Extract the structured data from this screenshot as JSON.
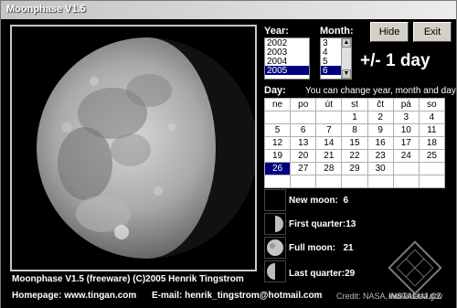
{
  "window": {
    "title": "Moonphase V1.5"
  },
  "year": {
    "label": "Year:",
    "options": [
      "2002",
      "2003",
      "2004",
      "2005"
    ],
    "selected": "2005"
  },
  "month": {
    "label": "Month:",
    "options": [
      "3",
      "4",
      "5",
      "6"
    ],
    "selected": "6"
  },
  "buttons": {
    "hide": "Hide",
    "exit": "Exit"
  },
  "step_label": "+/- 1 day",
  "day": {
    "label": "Day:",
    "hint": "You can change year, month and day"
  },
  "calendar": {
    "headers": [
      "ne",
      "po",
      "út",
      "st",
      "čt",
      "pá",
      "so"
    ],
    "weeks": [
      [
        "",
        "",
        "",
        "1",
        "2",
        "3",
        "4"
      ],
      [
        "5",
        "6",
        "7",
        "8",
        "9",
        "10",
        "11"
      ],
      [
        "12",
        "13",
        "14",
        "15",
        "16",
        "17",
        "18"
      ],
      [
        "19",
        "20",
        "21",
        "22",
        "23",
        "24",
        "25"
      ],
      [
        "26",
        "27",
        "28",
        "29",
        "30",
        "",
        ""
      ],
      [
        "",
        "",
        "",
        "",
        "",
        "",
        ""
      ]
    ],
    "today": "26"
  },
  "phases": {
    "new_moon": {
      "label": "New moon:",
      "day": "6"
    },
    "first_quarter": {
      "label": "First quarter:",
      "day": "13"
    },
    "full_moon": {
      "label": "Full moon:",
      "day": "21"
    },
    "last_quarter": {
      "label": "Last quarter:",
      "day": "29"
    }
  },
  "footer": {
    "line1": "Moonphase V1.5 (freeware) (C)2005 Henrik Tingstrom",
    "homepage": "Homepage: www.tingan.com",
    "email": "E-mail: henrik_tingstrom@hotmail.com",
    "credit": "Credit: NASA, www.nasa.gov"
  },
  "watermark": {
    "text": "INSTALUJ.CZ"
  }
}
